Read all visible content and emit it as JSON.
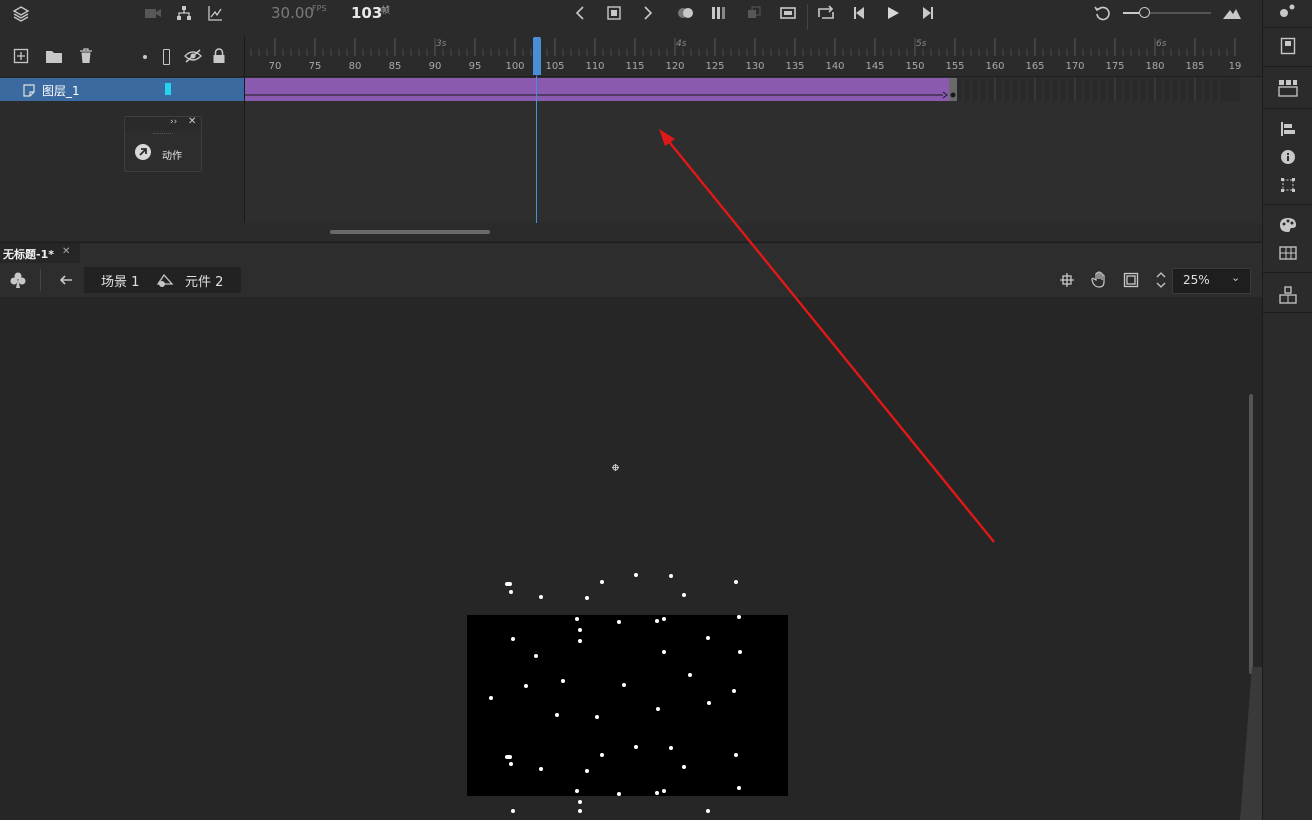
{
  "topbar": {
    "fps_value": "30.00",
    "fps_unit": "FPS",
    "frame_value": "103",
    "frame_unit": "帧"
  },
  "timeline": {
    "ruler_ticks": [
      "70",
      "75",
      "80",
      "85",
      "90",
      "95",
      "100",
      "105",
      "110",
      "115",
      "120",
      "125",
      "130",
      "135",
      "140",
      "145",
      "150",
      "155",
      "160",
      "165",
      "170",
      "175",
      "180",
      "185",
      "19"
    ],
    "seconds": [
      "3s",
      "4s",
      "5s",
      "6s"
    ],
    "current_frame": 103,
    "tween_end_frame": 154,
    "layer_name": "图层_1"
  },
  "actions_popup": {
    "label": "动作"
  },
  "document": {
    "tab_title": "无标题-1*"
  },
  "editbar": {
    "scene": "场景 1",
    "symbol": "元件 2",
    "zoom": "25%"
  },
  "colors": {
    "layer_highlight": "#3b6aa0",
    "tween_fill": "#8a5ab0",
    "playhead": "#4a8fd6",
    "annotation_arrow": "#e01818",
    "layer_color_swatch": "#27d4f0"
  },
  "icons": [
    "layers-icon",
    "camera-icon",
    "hierarchy-icon",
    "graph-icon",
    "prev-keyframe-icon",
    "stop-keyframe-icon",
    "next-keyframe-icon",
    "onion-skin-icon",
    "edit-multiple-frames-icon",
    "loop-icon",
    "insert-frame-icon",
    "first-frame-icon",
    "step-back-icon",
    "play-icon",
    "step-forward-icon",
    "undo-icon",
    "zoom-slider-icon",
    "mountain-icon"
  ]
}
